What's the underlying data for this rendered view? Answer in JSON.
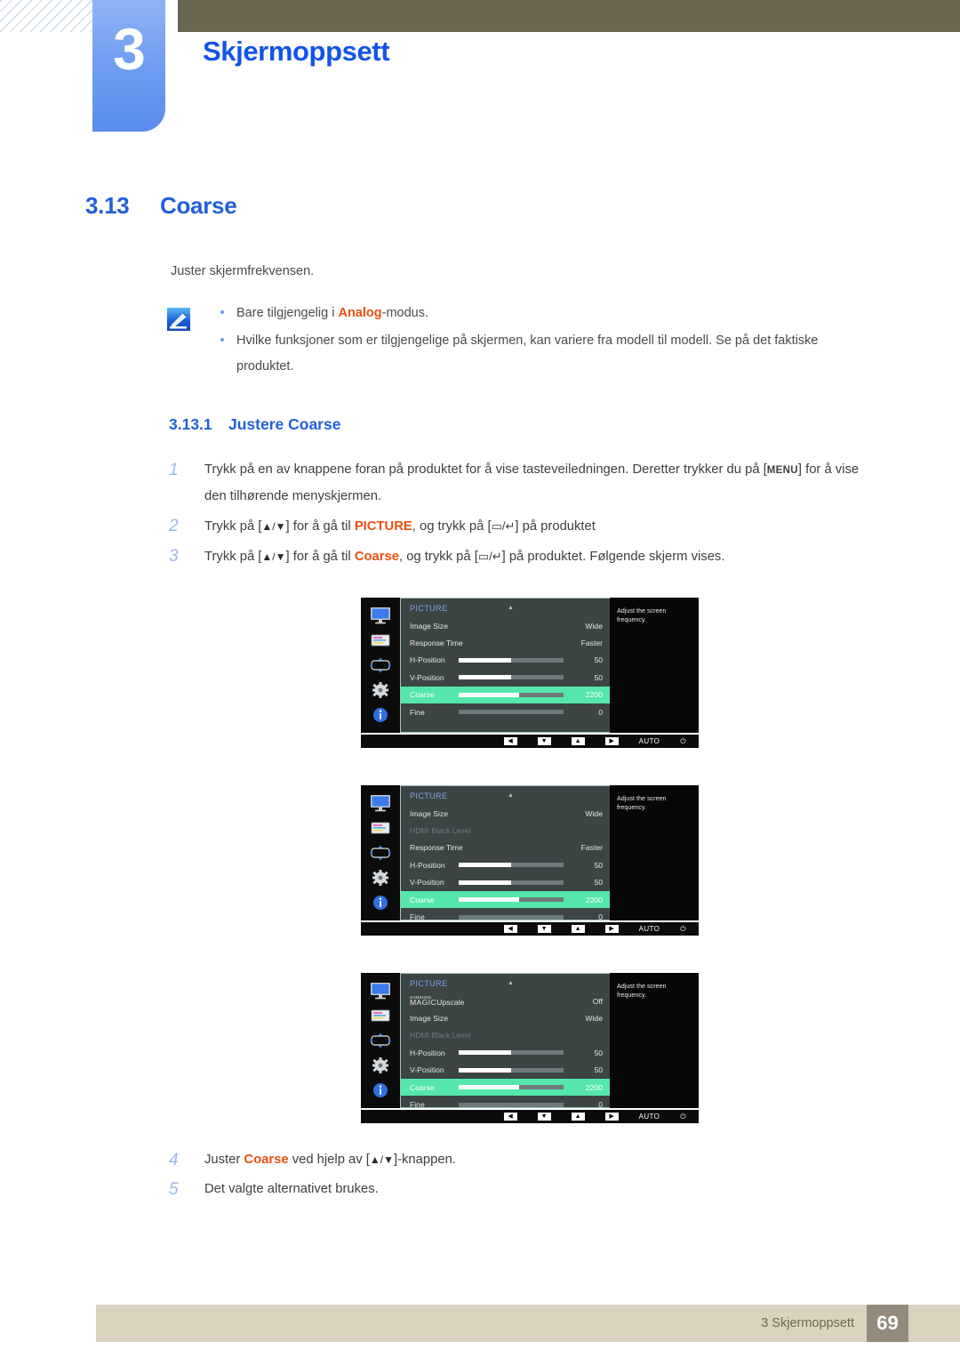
{
  "header": {
    "chapter_number": "3",
    "chapter_title": "Skjermoppsett"
  },
  "section": {
    "number": "3.13",
    "title": "Coarse",
    "intro": "Juster skjermfrekvensen.",
    "notes": [
      {
        "pre": "Bare tilgjengelig i ",
        "kw": "Analog",
        "post": "-modus."
      },
      {
        "pre": "Hvilke funksjoner som er tilgjengelige på skjermen, kan variere fra modell til modell. Se på det faktiske produktet.",
        "kw": "",
        "post": ""
      }
    ]
  },
  "subsection": {
    "number": "3.13.1",
    "title": "Justere Coarse"
  },
  "steps": [
    {
      "num": "1",
      "parts": [
        {
          "t": "Trykk på en av knappene foran på produktet for å vise tasteveiledningen. Deretter trykker du på [",
          "style": "plain"
        },
        {
          "t": "MENU",
          "style": "menukey"
        },
        {
          "t": "] for å vise den tilhørende menyskjermen.",
          "style": "plain"
        }
      ]
    },
    {
      "num": "2",
      "parts": [
        {
          "t": "Trykk på [",
          "style": "plain"
        },
        {
          "t": "▲/▼",
          "style": "arrow"
        },
        {
          "t": "] for å gå til ",
          "style": "plain"
        },
        {
          "t": "PICTURE",
          "style": "orange"
        },
        {
          "t": ", og trykk på [",
          "style": "plain"
        },
        {
          "t": "▭/↵",
          "style": "box"
        },
        {
          "t": "] på produktet",
          "style": "plain"
        }
      ]
    },
    {
      "num": "3",
      "parts": [
        {
          "t": "Trykk på [",
          "style": "plain"
        },
        {
          "t": "▲/▼",
          "style": "arrow"
        },
        {
          "t": "] for å gå til ",
          "style": "plain"
        },
        {
          "t": "Coarse",
          "style": "orange"
        },
        {
          "t": ", og trykk på [",
          "style": "plain"
        },
        {
          "t": "▭/↵",
          "style": "box"
        },
        {
          "t": "] på produktet. Følgende skjerm vises.",
          "style": "plain"
        }
      ]
    }
  ],
  "steps_bottom": [
    {
      "num": "4",
      "parts": [
        {
          "t": "Juster ",
          "style": "plain"
        },
        {
          "t": "Coarse",
          "style": "orange"
        },
        {
          "t": " ved hjelp av [",
          "style": "plain"
        },
        {
          "t": "▲/▼",
          "style": "arrow"
        },
        {
          "t": "]-knappen.",
          "style": "plain"
        }
      ]
    },
    {
      "num": "5",
      "parts": [
        {
          "t": "Det valgte alternativet brukes.",
          "style": "plain"
        }
      ]
    }
  ],
  "osd": {
    "title": "PICTURE",
    "description": "Adjust the screen frequency.",
    "footer_keys": [
      "◀",
      "▼",
      "▲",
      "▶"
    ],
    "footer_auto": "AUTO",
    "footer_power": "⏻",
    "sidebar_icons": [
      "picture-icon",
      "onscreen-display-icon",
      "system-icon",
      "setup-icon",
      "information-icon"
    ],
    "highlight_color": "#55e6ab",
    "title_color": "#7aa4e8",
    "menus": [
      {
        "rows": [
          {
            "label": "Image Size",
            "value": "Wide",
            "bar": null,
            "state": "normal"
          },
          {
            "label": "Response Time",
            "value": "Faster",
            "bar": null,
            "state": "normal"
          },
          {
            "label": "H-Position",
            "value": "50",
            "bar": 50,
            "state": "normal"
          },
          {
            "label": "V-Position",
            "value": "50",
            "bar": 50,
            "state": "normal"
          },
          {
            "label": "Coarse",
            "value": "2200",
            "bar": 58,
            "state": "highlight"
          },
          {
            "label": "Fine",
            "value": "0",
            "bar": 0,
            "state": "normal"
          }
        ]
      },
      {
        "rows": [
          {
            "label": "Image Size",
            "value": "Wide",
            "bar": null,
            "state": "normal"
          },
          {
            "label": "HDMI Black Level",
            "value": "",
            "bar": null,
            "state": "disabled"
          },
          {
            "label": "Response Time",
            "value": "Faster",
            "bar": null,
            "state": "normal"
          },
          {
            "label": "H-Position",
            "value": "50",
            "bar": 50,
            "state": "normal"
          },
          {
            "label": "V-Position",
            "value": "50",
            "bar": 50,
            "state": "normal"
          },
          {
            "label": "Coarse",
            "value": "2200",
            "bar": 58,
            "state": "highlight"
          },
          {
            "label": "Fine",
            "value": "0",
            "bar": 0,
            "state": "normal"
          }
        ]
      },
      {
        "rows": [
          {
            "label": "MAGICUpscale",
            "label_small": "SAMSUNG",
            "label_main": "MAGIC",
            "label_suffix": "Upscale",
            "value": "Off",
            "bar": null,
            "state": "magic"
          },
          {
            "label": "Image Size",
            "value": "Wide",
            "bar": null,
            "state": "normal"
          },
          {
            "label": "HDMI Black Level",
            "value": "",
            "bar": null,
            "state": "disabled"
          },
          {
            "label": "H-Position",
            "value": "50",
            "bar": 50,
            "state": "normal"
          },
          {
            "label": "V-Position",
            "value": "50",
            "bar": 50,
            "state": "normal"
          },
          {
            "label": "Coarse",
            "value": "2200",
            "bar": 58,
            "state": "highlight"
          },
          {
            "label": "Fine",
            "value": "0",
            "bar": 0,
            "state": "normal"
          }
        ]
      }
    ]
  },
  "footer": {
    "text": "3 Skjermoppsett",
    "page": "69"
  }
}
